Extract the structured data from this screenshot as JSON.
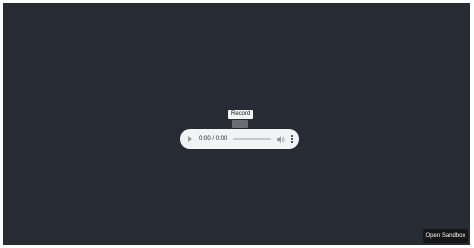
{
  "tooltip": {
    "label": "Record"
  },
  "audio": {
    "time": "0:00 / 0:00",
    "progress": 0
  },
  "sandbox_button": {
    "label": "Open Sandbox"
  },
  "colors": {
    "background": "#272b34",
    "player": "#f1f3f4",
    "sandbox_button": "#151515"
  },
  "icons": [
    "play-icon",
    "volume-icon",
    "more-options-icon"
  ]
}
